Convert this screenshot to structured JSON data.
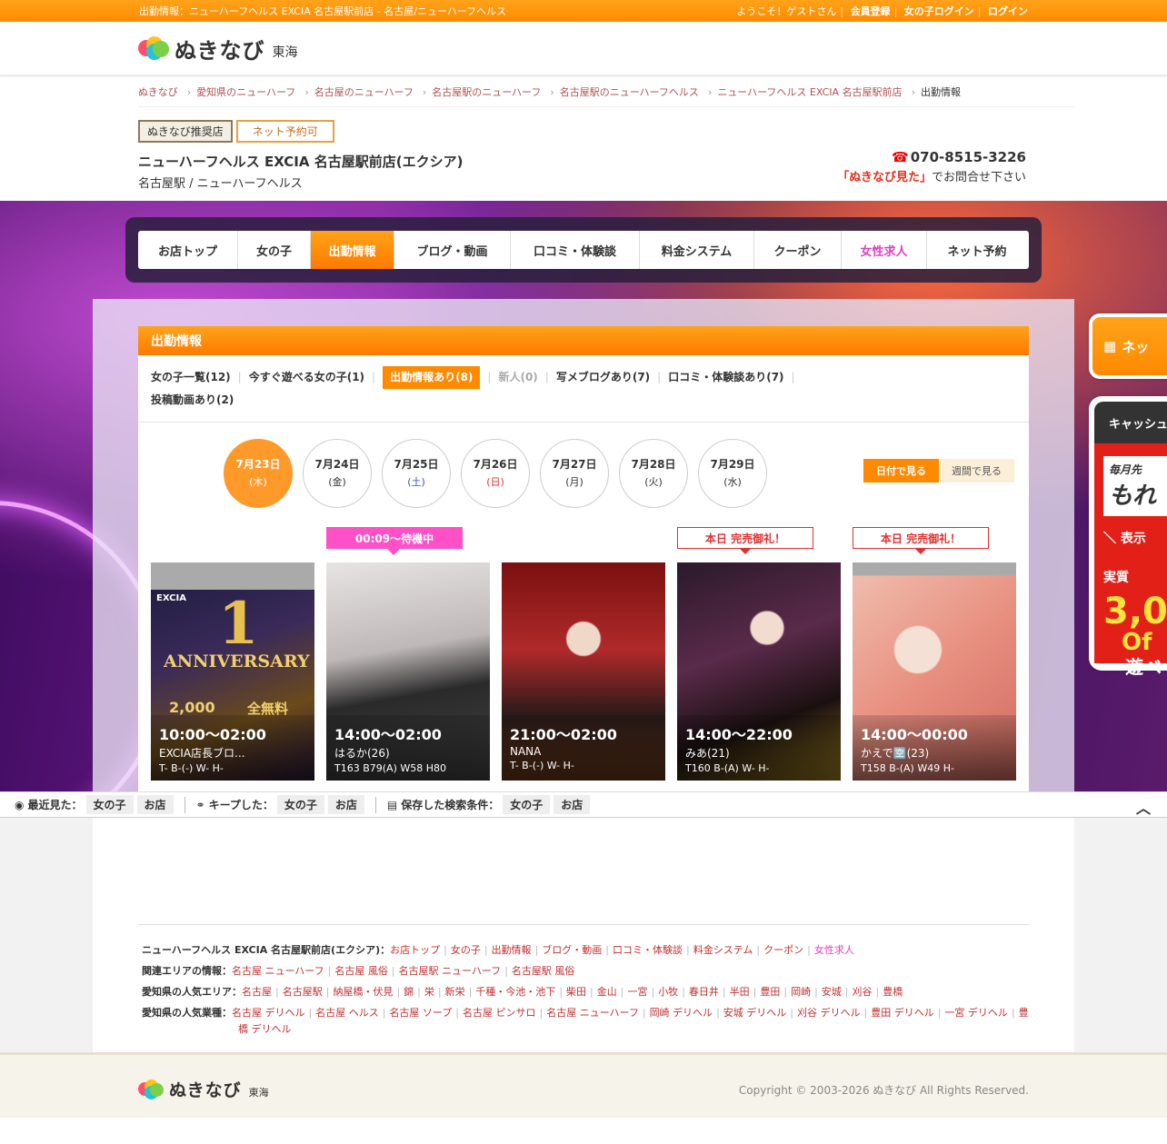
{
  "topbar": {
    "title": "出勤情報：ニューハーフヘルス EXCIA 名古屋駅前店 - 名古屋/ニューハーフヘルス",
    "welcome": "ようこそ！ゲストさん",
    "register": "会員登録",
    "girl_login": "女の子ログイン",
    "login": "ログイン"
  },
  "logo": {
    "word": "ぬきなび",
    "region": "東海"
  },
  "breadcrumb": [
    "ぬきなび",
    "愛知県のニューハーフ",
    "名古屋のニューハーフ",
    "名古屋駅のニューハーフ",
    "名古屋駅のニューハーフヘルス",
    "ニューハーフヘルス EXCIA 名古屋駅前店",
    "出勤情報"
  ],
  "shop": {
    "badge_recommended": "ぬきなび推奨店",
    "badge_reserve": "ネット予約可",
    "name": "ニューハーフヘルス EXCIA 名古屋駅前店(エクシア)",
    "category": "名古屋駅 / ニューハーフヘルス",
    "phone": "070-8515-3226",
    "phone_note_em": "「ぬきなび見た」",
    "phone_note": "でお問合せ下さい"
  },
  "nav": [
    "お店トップ",
    "女の子",
    "出勤情報",
    "ブログ・動画",
    "口コミ・体験談",
    "料金システム",
    "クーポン",
    "女性求人",
    "ネット予約"
  ],
  "schedule": {
    "heading": "出勤情報",
    "filters": [
      "女の子一覧(12)",
      "今すぐ遊べる女の子(1)",
      "出勤情報あり(8)",
      "新人(0)",
      "写メブログあり(7)",
      "口コミ・体験談あり(7)",
      "投稿動画あり(2)"
    ],
    "dates": [
      {
        "date": "7月23日",
        "day": "(木)"
      },
      {
        "date": "7月24日",
        "day": "(金)"
      },
      {
        "date": "7月25日",
        "day": "(土)"
      },
      {
        "date": "7月26日",
        "day": "(日)"
      },
      {
        "date": "7月27日",
        "day": "(月)"
      },
      {
        "date": "7月28日",
        "day": "(火)"
      },
      {
        "date": "7月29日",
        "day": "(水)"
      }
    ],
    "view_by_date": "日付で見る",
    "view_by_week": "週間で見る",
    "cards": [
      {
        "label": "",
        "time": "10:00〜02:00",
        "name": "EXCIA店長ブロ...",
        "size": "T- B-(-) W- H-",
        "banner_brand": "EXCIA",
        "banner_big": "1",
        "banner_word": "ANNIVERSARY",
        "banner_price": "2,000",
        "banner_free": "全無料"
      },
      {
        "label": "00:09〜待機中",
        "time": "14:00〜02:00",
        "name": "はるか(26)",
        "size": "T163 B79(A) W58 H80"
      },
      {
        "label": "",
        "time": "21:00〜02:00",
        "name": "NANA",
        "size": "T- B-(-) W- H-"
      },
      {
        "label": "本日 完売御礼！",
        "time": "14:00〜22:00",
        "name": "みあ(21)",
        "size": "T160 B-(A) W- H-"
      },
      {
        "label": "本日 完売御礼！",
        "time": "14:00〜00:00",
        "name": "かえで🈳(23)",
        "size": "T158 B-(A) W49 H-"
      }
    ]
  },
  "side": {
    "reserve": "ネッ",
    "cash_head": "キャッシュ",
    "cash_sub": "毎月先",
    "cash_big": "もれ",
    "cash_note": "＼ 表示",
    "cash_real": "実質",
    "cash_num": "3,0",
    "cash_of": "Of",
    "cash_play": "遊べ"
  },
  "history": {
    "recent": "最近見た：",
    "kept": "キープした：",
    "saved": "保存した検索条件：",
    "girl": "女の子",
    "shop": "お店"
  },
  "links": {
    "shop_label": "ニューハーフヘルス EXCIA 名古屋駅前店(エクシア)：",
    "shop_links": [
      "お店トップ",
      "女の子",
      "出勤情報",
      "ブログ・動画",
      "口コミ・体験談",
      "料金システム",
      "クーポン",
      "女性求人"
    ],
    "area_label": "関連エリアの情報：",
    "area_links": [
      "名古屋 ニューハーフ",
      "名古屋 風俗",
      "名古屋駅 ニューハーフ",
      "名古屋駅 風俗"
    ],
    "popular_area_label": "愛知県の人気エリア：",
    "popular_areas": [
      "名古屋",
      "名古屋駅",
      "納屋橋・伏見",
      "錦",
      "栄",
      "新栄",
      "千種・今池・池下",
      "柴田",
      "金山",
      "一宮",
      "小牧",
      "春日井",
      "半田",
      "豊田",
      "岡崎",
      "安城",
      "刈谷",
      "豊橋"
    ],
    "popular_type_label": "愛知県の人気業種：",
    "popular_types": [
      "名古屋 デリヘル",
      "名古屋 ヘルス",
      "名古屋 ソープ",
      "名古屋 ピンサロ",
      "名古屋 ニューハーフ",
      "岡崎 デリヘル",
      "安城 デリヘル",
      "刈谷 デリヘル",
      "豊田 デリヘル",
      "一宮 デリヘル",
      "豊橋 デリヘル"
    ]
  },
  "footer": {
    "copyright": "Copyright © 2003-2026 ぬきなび All Rights Reserved."
  },
  "colors": {
    "accent": "#ff8a00",
    "pink": "#ff50c8",
    "red": "#e03030"
  }
}
